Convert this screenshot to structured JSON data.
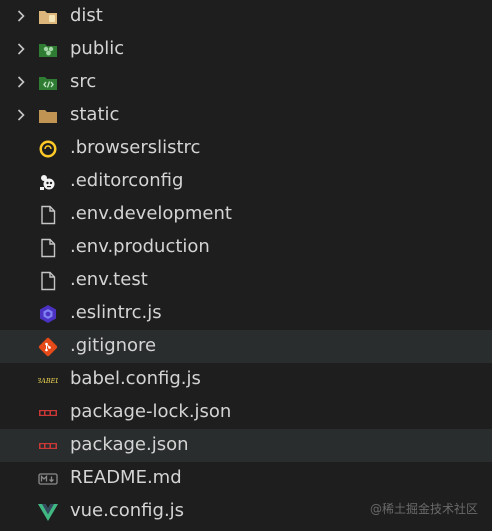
{
  "explorer": {
    "items": [
      {
        "label": "dist",
        "kind": "folder",
        "icon": "dist-folder-icon",
        "color": "#dcb67a"
      },
      {
        "label": "public",
        "kind": "folder",
        "icon": "public-folder-icon",
        "color": "#4caf50"
      },
      {
        "label": "src",
        "kind": "folder",
        "icon": "src-folder-icon",
        "color": "#4caf50"
      },
      {
        "label": "static",
        "kind": "folder",
        "icon": "static-folder-icon",
        "color": "#c09553"
      },
      {
        "label": ".browserslistrc",
        "kind": "file",
        "icon": "browserslist-icon",
        "color": "#ffca28"
      },
      {
        "label": ".editorconfig",
        "kind": "file",
        "icon": "editorconfig-icon",
        "color": "#ffffff"
      },
      {
        "label": ".env.development",
        "kind": "file",
        "icon": "file-icon",
        "color": "#c5c5c5"
      },
      {
        "label": ".env.production",
        "kind": "file",
        "icon": "file-icon",
        "color": "#c5c5c5"
      },
      {
        "label": ".env.test",
        "kind": "file",
        "icon": "file-icon",
        "color": "#c5c5c5"
      },
      {
        "label": ".eslintrc.js",
        "kind": "file",
        "icon": "eslint-icon",
        "color": "#7c4dff"
      },
      {
        "label": ".gitignore",
        "kind": "file",
        "icon": "git-icon",
        "color": "#e64a19"
      },
      {
        "label": "babel.config.js",
        "kind": "file",
        "icon": "babel-icon",
        "color": "#f5da55"
      },
      {
        "label": "package-lock.json",
        "kind": "file",
        "icon": "npm-lock-icon",
        "color": "#cb3837"
      },
      {
        "label": "package.json",
        "kind": "file",
        "icon": "npm-icon",
        "color": "#cb3837"
      },
      {
        "label": "README.md",
        "kind": "file",
        "icon": "markdown-icon",
        "color": "#8a8a8a"
      },
      {
        "label": "vue.config.js",
        "kind": "file",
        "icon": "vue-icon",
        "color": "#41b883"
      }
    ]
  },
  "watermark": "@稀土掘金技术社区"
}
